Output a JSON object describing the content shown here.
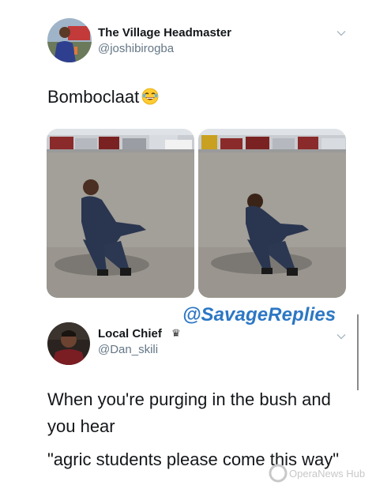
{
  "tweet1": {
    "display_name": "The Village Headmaster",
    "handle": "@joshibirogba",
    "text": "Bomboclaat",
    "emoji": "joy-emoji-icon",
    "menu_icon": "chevron-down-icon"
  },
  "watermark": {
    "text": "@SavageReplies",
    "color": "#2c77c4"
  },
  "tweet2": {
    "display_name": "Local Chief",
    "badge": "♛",
    "handle": "@Dan_skili",
    "menu_icon": "chevron-down-icon",
    "text_lines": [
      "When you're purging in the bush and",
      "you hear",
      "\"agric students please come this way\""
    ]
  },
  "corner_logo": {
    "text": "OperaNews Hub"
  },
  "colors": {
    "text": "#14171a",
    "secondary": "#657786",
    "background": "#ffffff"
  }
}
